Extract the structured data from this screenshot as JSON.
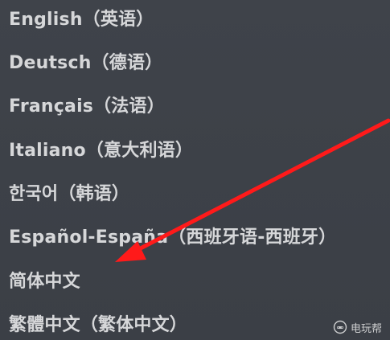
{
  "languages": [
    {
      "label": "English（英语）"
    },
    {
      "label": "Deutsch（德语）"
    },
    {
      "label": "Français（法语）"
    },
    {
      "label": "Italiano（意大利语）"
    },
    {
      "label": "한국어（韩语）"
    },
    {
      "label": "Español-España（西班牙语-西班牙）"
    },
    {
      "label": "简体中文"
    },
    {
      "label": "繁體中文（繁体中文）"
    }
  ],
  "annotation": {
    "arrow_color": "#ff1a1a",
    "points_to": "简体中文"
  },
  "watermark": {
    "text": "电玩帮",
    "icon": "controller-logo-icon"
  }
}
